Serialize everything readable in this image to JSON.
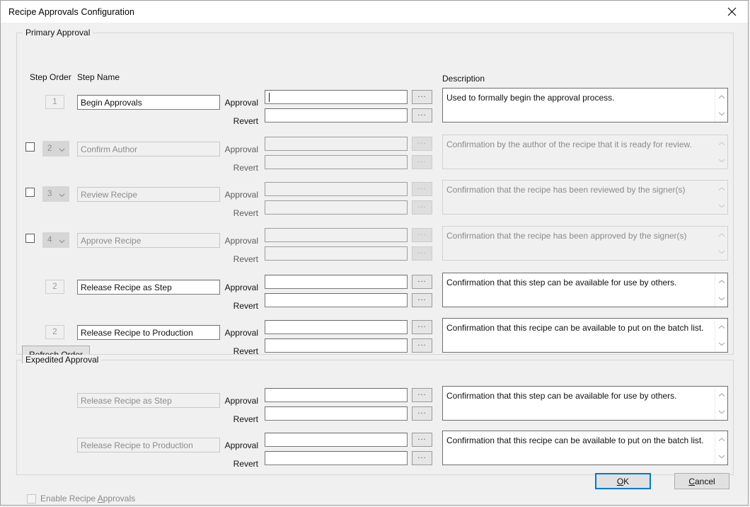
{
  "window": {
    "title": "Recipe Approvals Configuration",
    "close_icon": "close-icon"
  },
  "primary_group": {
    "title": "Primary Approval",
    "headers": {
      "step_order": "Step Order",
      "step_name": "Step Name",
      "description": "Description"
    },
    "refresh_button": {
      "label": "Refresh Order",
      "accel": "R",
      "rest": "efresh Order"
    },
    "rows": [
      {
        "has_checkbox": false,
        "checked": false,
        "order_control": "textbox",
        "order_value": "1",
        "step_name": "Begin Approvals",
        "enabled": true,
        "approval_label": "Approval",
        "approval_value": "",
        "revert_label": "Revert",
        "revert_value": "",
        "description": "Used to formally begin the approval process.",
        "focused": true,
        "dots_label": "..."
      },
      {
        "has_checkbox": true,
        "checked": false,
        "order_control": "combo",
        "order_value": "2",
        "step_name": "Confirm Author",
        "enabled": false,
        "approval_label": "Approval",
        "approval_value": "",
        "revert_label": "Revert",
        "revert_value": "",
        "description": "Confirmation by the author of the recipe that it is ready for review.",
        "focused": false,
        "dots_label": "..."
      },
      {
        "has_checkbox": true,
        "checked": false,
        "order_control": "combo",
        "order_value": "3",
        "step_name": "Review Recipe",
        "enabled": false,
        "approval_label": "Approval",
        "approval_value": "",
        "revert_label": "Revert",
        "revert_value": "",
        "description": "Confirmation that the recipe has been reviewed by the signer(s)",
        "focused": false,
        "dots_label": "..."
      },
      {
        "has_checkbox": true,
        "checked": false,
        "order_control": "combo",
        "order_value": "4",
        "step_name": "Approve Recipe",
        "enabled": false,
        "approval_label": "Approval",
        "approval_value": "",
        "revert_label": "Revert",
        "revert_value": "",
        "description": "Confirmation that the recipe has been approved by the signer(s)",
        "focused": false,
        "dots_label": "..."
      },
      {
        "has_checkbox": false,
        "checked": false,
        "order_control": "textbox",
        "order_value": "2",
        "step_name": "Release Recipe as Step",
        "enabled": true,
        "approval_label": "Approval",
        "approval_value": "",
        "revert_label": "Revert",
        "revert_value": "",
        "description": "Confirmation that this step can be available for use by others.",
        "focused": false,
        "dots_label": "..."
      },
      {
        "has_checkbox": false,
        "checked": false,
        "order_control": "textbox",
        "order_value": "2",
        "step_name": "Release Recipe to Production",
        "enabled": true,
        "approval_label": "Approval",
        "approval_value": "",
        "revert_label": "Revert",
        "revert_value": "",
        "description": "Confirmation that this recipe can be available to put on the batch list.",
        "focused": false,
        "dots_label": "..."
      }
    ]
  },
  "expedited_group": {
    "title": "Expedited Approval",
    "rows": [
      {
        "step_name": "Release Recipe as Step",
        "approval_label": "Approval",
        "approval_value": "",
        "revert_label": "Revert",
        "revert_value": "",
        "description": "Confirmation that this step can be available for use by others.",
        "dots_label": "..."
      },
      {
        "step_name": "Release Recipe to Production",
        "approval_label": "Approval",
        "approval_value": "",
        "revert_label": "Revert",
        "revert_value": "",
        "description": "Confirmation that this recipe can be available to put on the batch list.",
        "dots_label": "..."
      }
    ]
  },
  "footer": {
    "enable_checkbox": {
      "checked": false,
      "label_pre": "Enable Recipe ",
      "label_accel": "A",
      "label_post": "pprovals"
    },
    "ok_button": {
      "accel": "O",
      "rest": "K"
    },
    "cancel_button": {
      "accel": "C",
      "rest": "ancel"
    }
  },
  "colors": {
    "dialog_background": "#f0f0f0",
    "titlebar_background": "#ffffff",
    "focus_accent": "#0078d7",
    "disabled_text": "#8b8b8b",
    "border": "#a0a0a0"
  }
}
